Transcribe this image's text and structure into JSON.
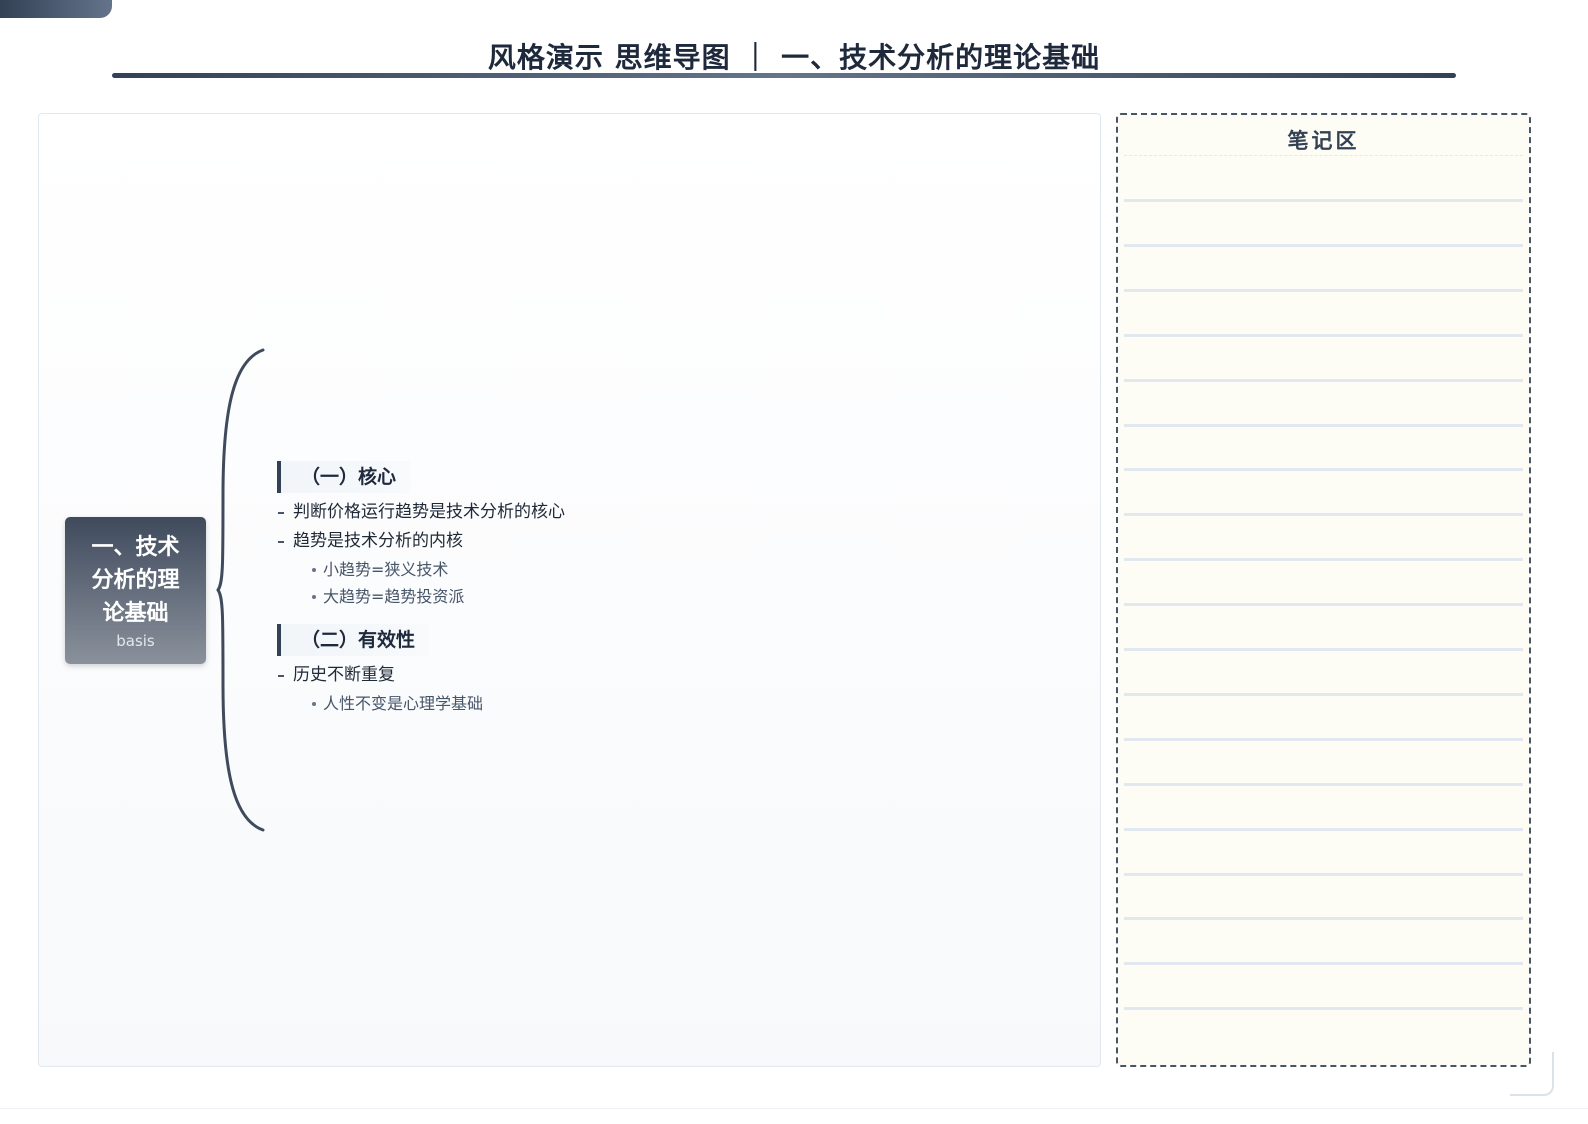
{
  "header": {
    "title": "风格演示 思维导图 ｜ 一、技术分析的理论基础"
  },
  "colors": {
    "accent": "#334155",
    "notes_background": "#fdfdf5",
    "note_lines": "#e2e8f0"
  },
  "mindmap": {
    "root": {
      "title": "一、技术分析的理论基础",
      "subtitle": "basis"
    },
    "branches": [
      {
        "label": "（一）核心",
        "items": [
          {
            "text": "判断价格运行趋势是技术分析的核心",
            "children": []
          },
          {
            "text": "趋势是技术分析的内核",
            "children": [
              "小趋势=狭义技术",
              "大趋势=趋势投资派"
            ]
          }
        ]
      },
      {
        "label": "（二）有效性",
        "items": [
          {
            "text": "历史不断重复",
            "children": [
              "人性不变是心理学基础"
            ]
          }
        ]
      }
    ]
  },
  "notes": {
    "title": "笔记区",
    "line_count": 19
  }
}
